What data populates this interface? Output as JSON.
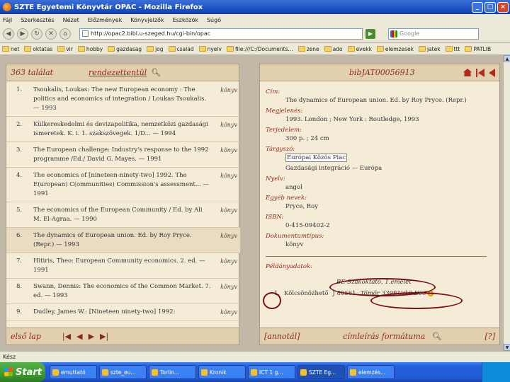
{
  "window": {
    "title": "SZTE Egyetemi Könyvtár OPAC - Mozilla Firefox",
    "minimize": "_",
    "maximize": "□",
    "close": "×"
  },
  "menu": [
    "Fájl",
    "Szerkesztés",
    "Nézet",
    "Előzmények",
    "Könyvjelzők",
    "Eszközök",
    "Súgó"
  ],
  "nav": {
    "url": "http://opac2.bibl.u-szeged.hu/cgi-bin/opac",
    "search_placeholder": "Google"
  },
  "bookmarks": [
    "net",
    "oktatas",
    "vir",
    "hobby",
    "gazdasag",
    "jog",
    "csalad",
    "nyelv",
    "file:///C:/Documents...",
    "zene",
    "ado",
    "evekk",
    "elemzesek",
    "jatek",
    "ttt",
    "PATLIB"
  ],
  "left": {
    "hits": "363 találat",
    "sort_label": "rendezettentül",
    "results": [
      {
        "num": "1.",
        "text": "Tsoukalis, Loukas: The new European economy : The politics and economics of integration / Loukas Tsoukalis. — 1993",
        "type": "könyv"
      },
      {
        "num": "2.",
        "text": "Külkereskedelmi és devizapolitika, nemzetközi gazdasági ismeretek. K. i. 1. szakszövegek. 1/D... — 1994",
        "type": "könyv"
      },
      {
        "num": "3.",
        "text": "The European challenge: Industry's response to the 1992 programme /Ed./ David G. Mayes. — 1991",
        "type": "könyv"
      },
      {
        "num": "4.",
        "text": "The economics of [nineteen-ninety-two] 1992. The E(uropean) C(ommunities) Commission's assessment... — 1991",
        "type": "könyv"
      },
      {
        "num": "5.",
        "text": "The economics of the European Community / Ed. by Ali M. El-Agraa. — 1990",
        "type": "könyv"
      },
      {
        "num": "6.",
        "text": "The dynamics of European union. Ed. by Roy Pryce. (Repr.) — 1993",
        "type": "könyv"
      },
      {
        "num": "7.",
        "text": "Hitiris, Theo: European Community economics. 2. ed. — 1991",
        "type": "könyv"
      },
      {
        "num": "8.",
        "text": "Swann, Dennis: The economics of the Common Market. 7. ed. — 1993",
        "type": "könyv"
      },
      {
        "num": "9.",
        "text": "Dudley, James W.: [Nineteen ninety-two] 1992:",
        "type": "könyv"
      }
    ],
    "footer_label": "első lap",
    "pager": [
      "|◀",
      "◀",
      "▶",
      "▶|"
    ]
  },
  "right": {
    "record_id": "bibJAT00056913",
    "fields": [
      {
        "label": "Cím:",
        "value": "The dynamics of European union. Ed. by Roy Pryce. (Repr.)"
      },
      {
        "label": "Megjelenés:",
        "value": "1993. London ; New York : Routledge, 1993"
      },
      {
        "label": "Terjedelem:",
        "value": "300 p. ; 24 cm"
      },
      {
        "label": "Tárgyszó:",
        "value": "Európai Közös Piac"
      },
      {
        "label": "",
        "value": "Gazdasági integráció — Európa"
      },
      {
        "label": "Nyelv:",
        "value": "angol"
      },
      {
        "label": "Egyéb nevek:",
        "value": "Pryce, Roy"
      },
      {
        "label": "ISBN:",
        "value": "0-415-09402-2"
      },
      {
        "label": "Dokumentumtípus:",
        "value": "könyv"
      }
    ],
    "copies_label": "Példányadatok:",
    "library": "BE Szakoktató, 1.emelet",
    "copy_num": "1.",
    "copy_status": "Kölcsönözhető",
    "copy_barcode": "J 80561",
    "copy_shelf": "Tömör 339EU/10 D99",
    "footer_left": "[annotál]",
    "footer_mid": "címleírás formátuma",
    "footer_right": "[?]"
  },
  "status": "Kész",
  "taskbar": {
    "start": "Start",
    "tasks": [
      "emuttató",
      "szte_eu...",
      "Torlin...",
      "Kronik",
      "ICT 1 g...",
      "SZTE Eg...",
      "elemzés..."
    ]
  }
}
